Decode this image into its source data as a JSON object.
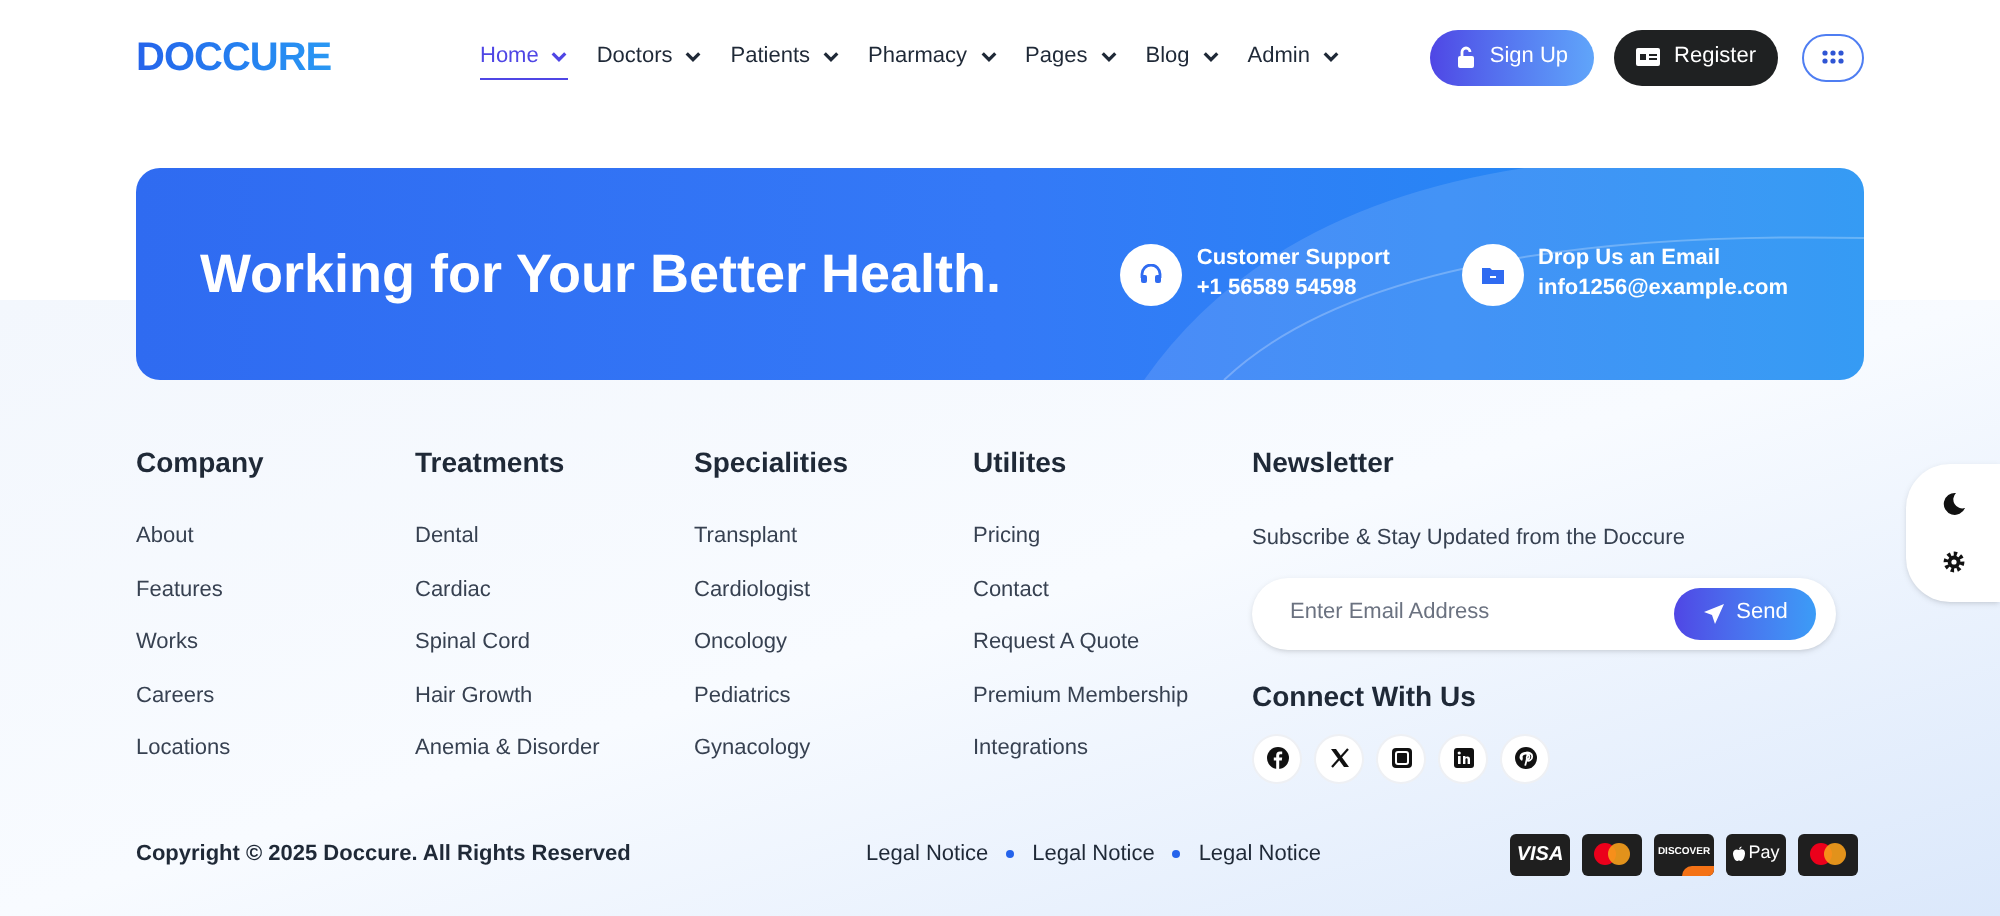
{
  "header": {
    "logo": "DOCCURE",
    "nav": [
      {
        "label": "Home",
        "selected": true
      },
      {
        "label": "Doctors",
        "selected": false
      },
      {
        "label": "Patients",
        "selected": false
      },
      {
        "label": "Pharmacy",
        "selected": false
      },
      {
        "label": "Pages",
        "selected": false
      },
      {
        "label": "Blog",
        "selected": false
      },
      {
        "label": "Admin",
        "selected": false
      }
    ],
    "buttons": [
      {
        "kind": "signup",
        "label": "Sign Up"
      },
      {
        "kind": "register",
        "label": "Register"
      },
      {
        "kind": "apps"
      }
    ]
  },
  "banner": {
    "title": "Working for Your Better Health.",
    "contacts": [
      {
        "kind": "support",
        "label": "Customer Support",
        "value": "+1 56589 54598"
      },
      {
        "kind": "email",
        "label": "Drop Us an Email",
        "value": "info1256@example.com"
      }
    ]
  },
  "columns": [
    {
      "title": "Company",
      "links": [
        "About",
        "Features",
        "Works",
        "Careers",
        "Locations"
      ]
    },
    {
      "title": "Treatments",
      "links": [
        "Dental",
        "Cardiac",
        "Spinal Cord",
        "Hair Growth",
        "Anemia & Disorder"
      ]
    },
    {
      "title": "Specialities",
      "links": [
        "Transplant",
        "Cardiologist",
        "Oncology",
        "Pediatrics",
        "Gynacology"
      ]
    },
    {
      "title": "Utilites",
      "links": [
        "Pricing",
        "Contact",
        "Request A Quote",
        "Premium Membership",
        "Integrations"
      ]
    }
  ],
  "newsletter": {
    "title": "Newsletter",
    "text": "Subscribe & Stay Updated from the Doccure",
    "placeholder": "Enter Email Address",
    "button": "Send",
    "connect_title": "Connect With Us",
    "socials": [
      {
        "kind": "facebook"
      },
      {
        "kind": "x"
      },
      {
        "kind": "instagram"
      },
      {
        "kind": "linkedin"
      },
      {
        "kind": "pinterest"
      }
    ]
  },
  "footer": {
    "copyright": "Copyright © 2025 Doccure. All Rights Reserved",
    "links": [
      "Legal Notice",
      "Legal Notice",
      "Legal Notice"
    ],
    "payments": [
      {
        "kind": "visa",
        "label": "VISA"
      },
      {
        "kind": "mastercard"
      },
      {
        "kind": "discover",
        "label": "DISCOVER"
      },
      {
        "kind": "applepay",
        "label": "Pay"
      },
      {
        "kind": "mastercard"
      }
    ]
  },
  "theme_widget": [
    {
      "kind": "dark-mode"
    },
    {
      "kind": "settings"
    }
  ]
}
